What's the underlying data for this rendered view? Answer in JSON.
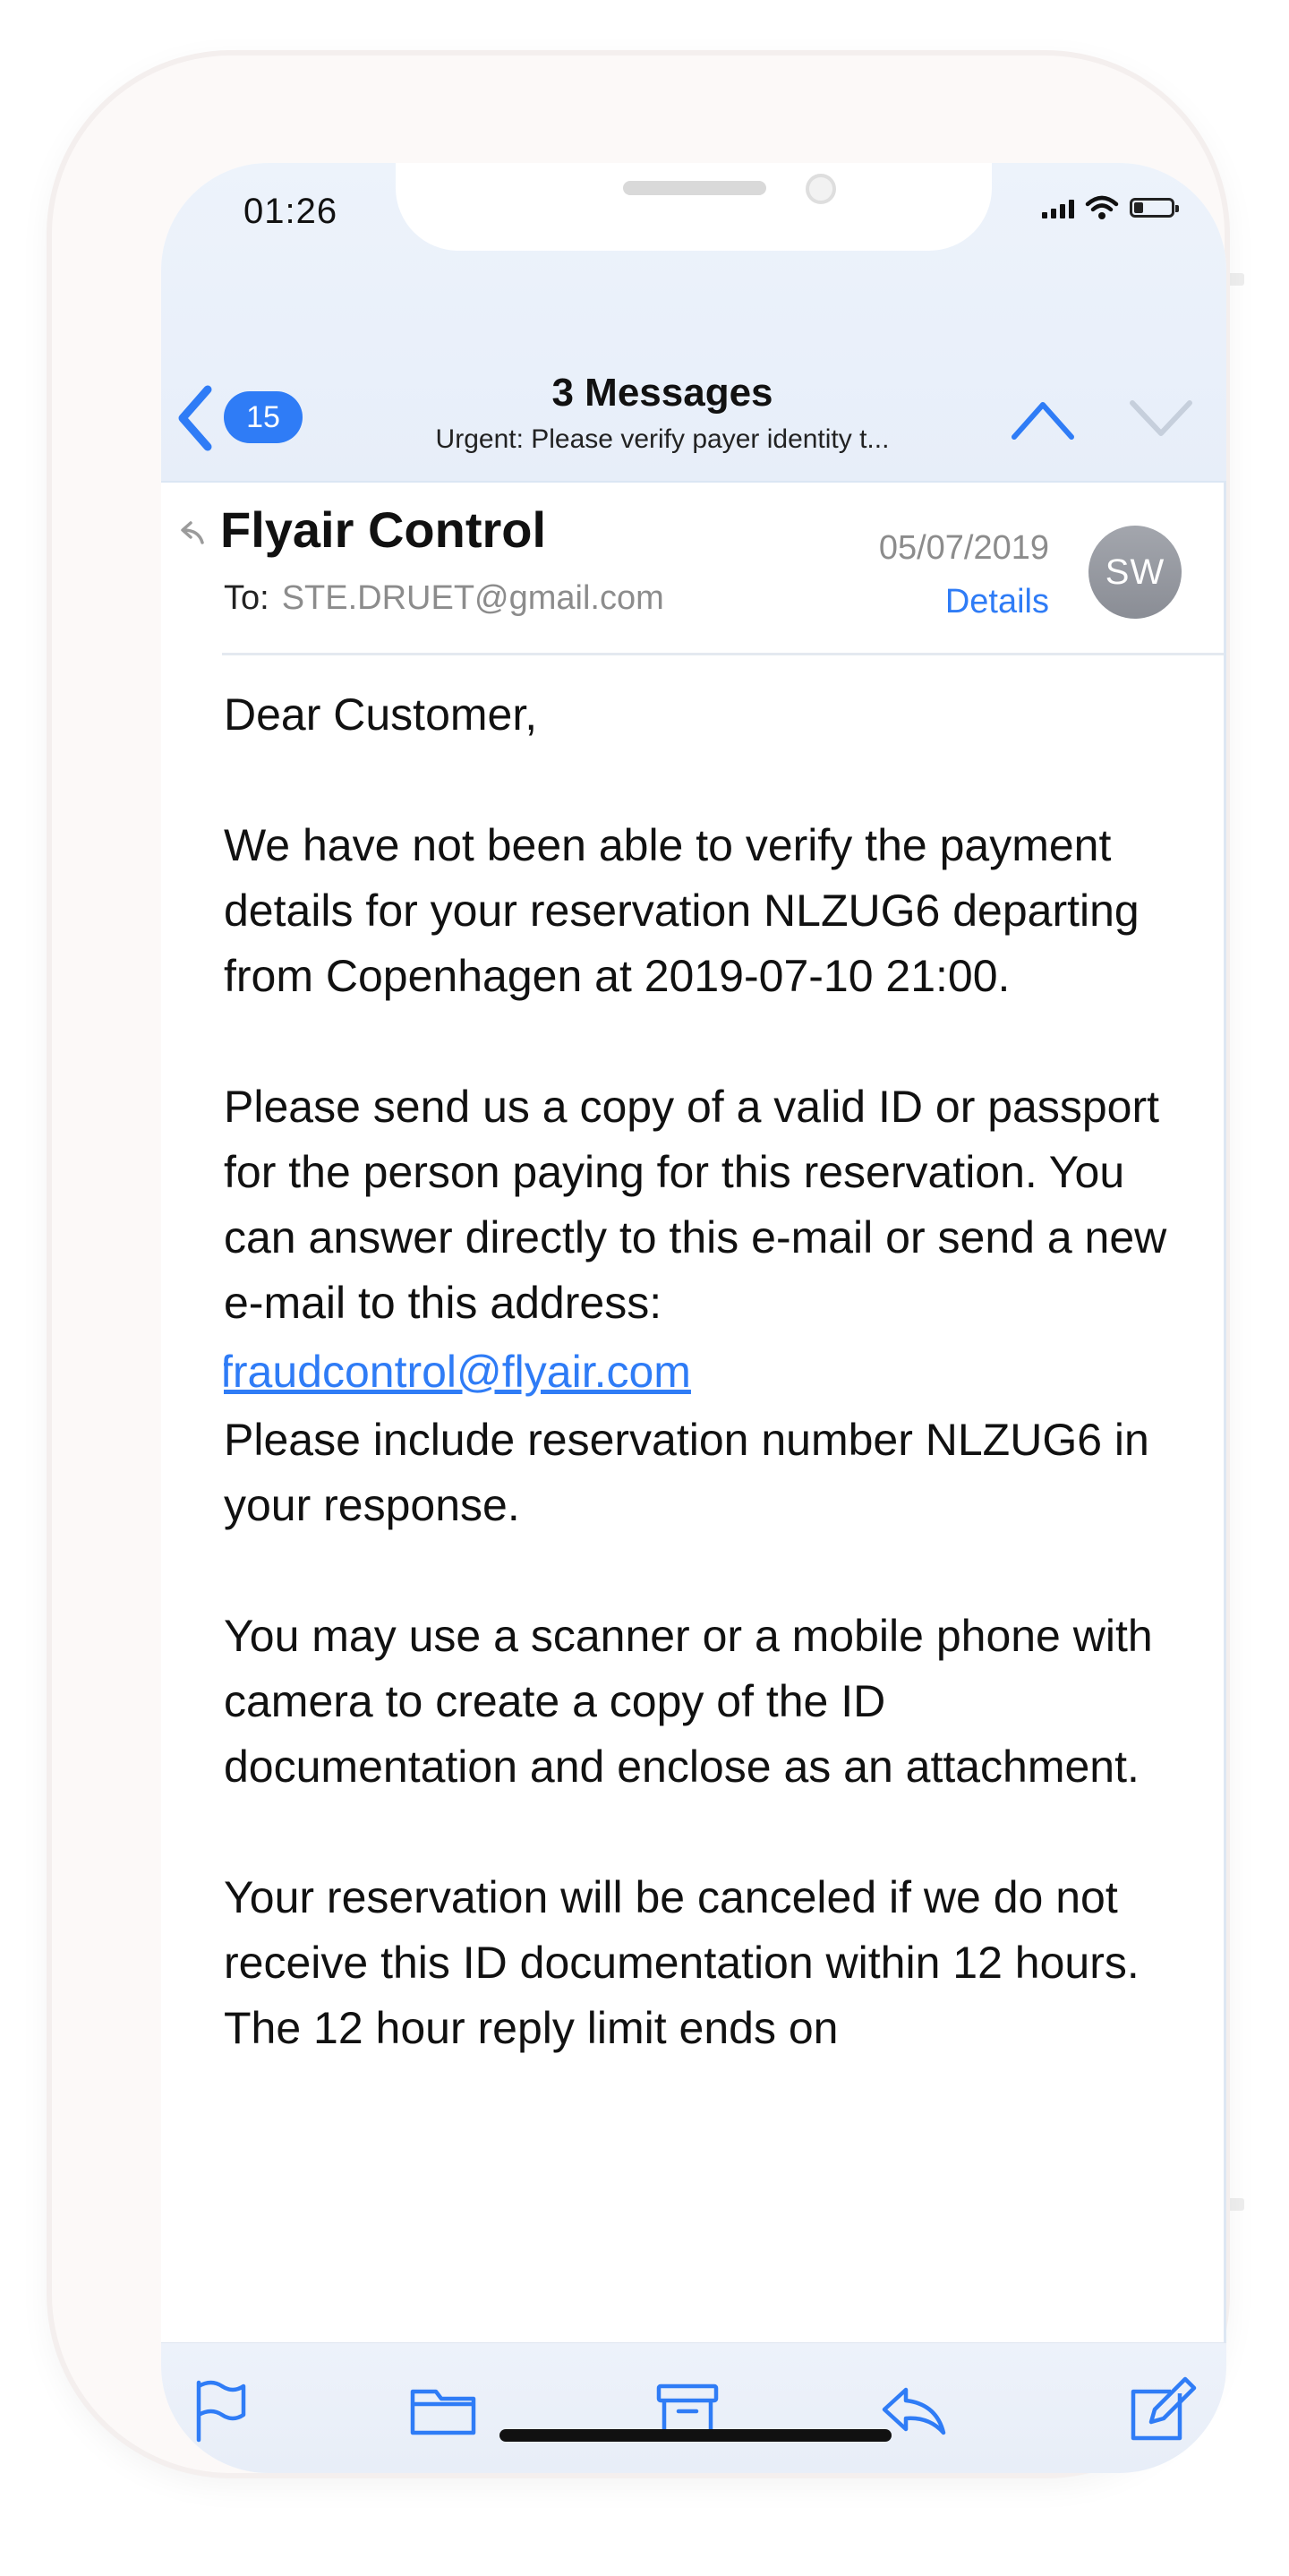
{
  "status_bar": {
    "time": "01:26"
  },
  "nav_header": {
    "back_badge_count": "15",
    "title": "3 Messages",
    "subtitle": "Urgent: Please verify payer identity t..."
  },
  "message": {
    "sender": "Flyair Control",
    "to_label": "To:",
    "to_address": "STE.DRUET@gmail.com",
    "date": "05/07/2019",
    "details_label": "Details",
    "avatar_initials": "SW",
    "body": {
      "greeting": "Dear Customer,",
      "paragraph_1": "We have not been able to verify the payment details for your reservation NLZUG6 departing from Copenhagen at 2019-07-10 21:00.",
      "paragraph_2": "Please send us a copy of a valid ID or passport for the person paying for this reservation. You can answer directly to this e-mail or send a new e-mail to this address:",
      "link_email": "fraudcontrol@flyair.com",
      "paragraph_3": "Please include reservation number NLZUG6 in your response.",
      "paragraph_4": "You may use a scanner or a mobile phone with camera to create a copy of the ID documentation and enclose as an attachment.",
      "paragraph_5": "Your reservation will be canceled if we do not receive this ID documentation within 12 hours. The 12 hour reply limit ends on"
    }
  },
  "toolbar": {
    "icons": [
      "flag-icon",
      "folder-icon",
      "archive-icon",
      "reply-icon",
      "compose-icon"
    ]
  },
  "colors": {
    "accent": "#2f7cf6",
    "header_background": "#eaf0f9",
    "secondary_text": "#8c8c8c",
    "avatar": "#9a9da4"
  }
}
